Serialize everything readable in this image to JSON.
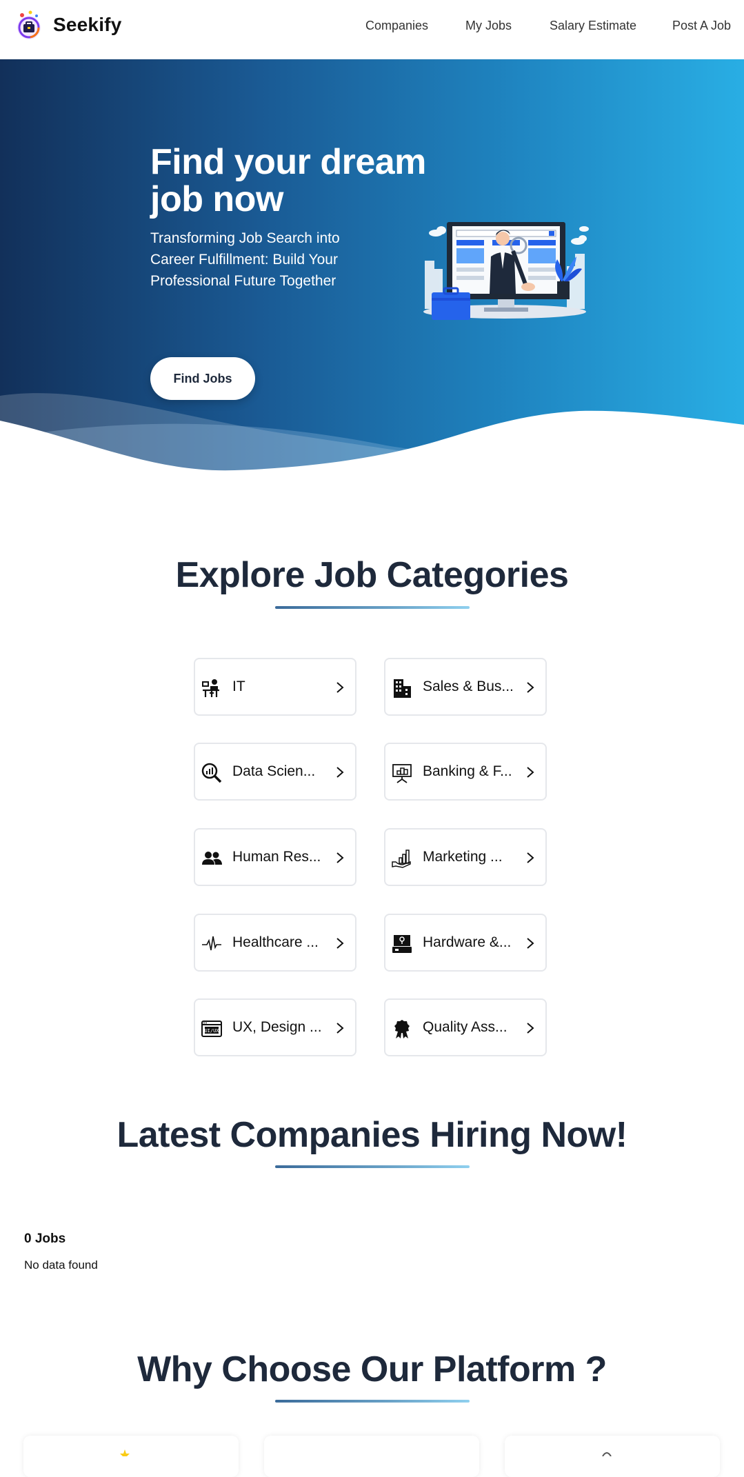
{
  "header": {
    "brand": "Seekify",
    "nav": [
      "Companies",
      "My Jobs",
      "Salary Estimate",
      "Post A Job"
    ]
  },
  "hero": {
    "title": "Find your dream job now",
    "subtitle": "Transforming Job Search into Career Fulfillment: Build Your Professional Future Together",
    "button": "Find Jobs"
  },
  "categories": {
    "title": "Explore Job Categories",
    "items": [
      {
        "label": "IT",
        "icon": "developer-at-desk-icon"
      },
      {
        "label": "Sales & Bus...",
        "icon": "office-building-icon"
      },
      {
        "label": "Data Scien...",
        "icon": "data-magnifier-icon"
      },
      {
        "label": "Banking & F...",
        "icon": "presentation-board-icon"
      },
      {
        "label": "Human Res...",
        "icon": "people-group-icon"
      },
      {
        "label": "Marketing ...",
        "icon": "hand-growth-chart-icon"
      },
      {
        "label": "Healthcare ...",
        "icon": "heartbeat-pulse-icon"
      },
      {
        "label": "Hardware &...",
        "icon": "server-drive-icon"
      },
      {
        "label": "UX, Design ...",
        "icon": "ui-ux-window-icon"
      },
      {
        "label": "Quality Ass...",
        "icon": "award-ribbon-icon"
      }
    ]
  },
  "companies": {
    "title": "Latest Companies Hiring Now!",
    "jobs_count": "0 Jobs",
    "empty_message": "No data found"
  },
  "platform": {
    "title": "Why Choose Our Platform ?"
  },
  "colors": {
    "hero_start": "#12305a",
    "hero_end": "#29aee4",
    "heading": "#1e293b",
    "accent": "#2563eb"
  }
}
